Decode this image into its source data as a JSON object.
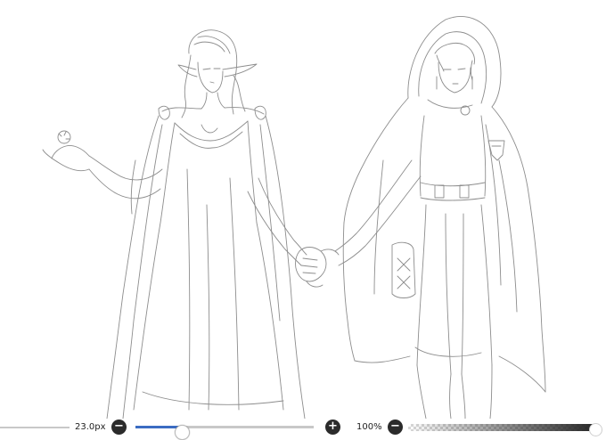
{
  "canvas": {
    "subject": "pencil line sketch",
    "stroke_color": "#8d8d8d"
  },
  "toolbar": {
    "brush_size_label": "23.0px",
    "brush_size_fraction": 0.26,
    "opacity_label": "100%",
    "opacity_fraction": 1.0,
    "decrease_icon": "minus-icon",
    "increase_icon": "plus-icon",
    "accent_color": "#3b6cc2"
  }
}
